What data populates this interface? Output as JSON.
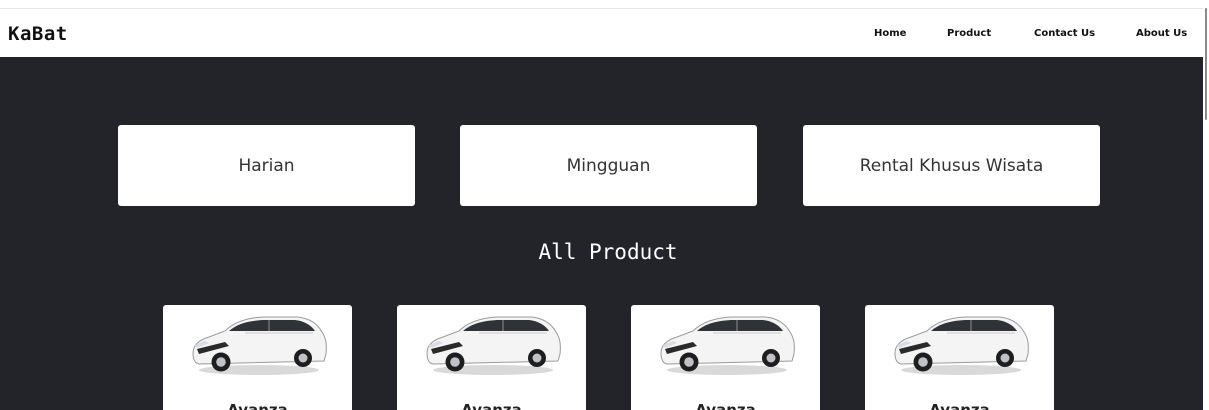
{
  "navbar": {
    "brand": "KaBat",
    "links": [
      "Home",
      "Product",
      "Contact Us",
      "About Us"
    ]
  },
  "categories": [
    "Harian",
    "Mingguan",
    "Rental Khusus Wisata"
  ],
  "section_title": "All Product",
  "products": [
    {
      "name": "Avanza",
      "image": "white-minivan-image"
    },
    {
      "name": "Avanza",
      "image": "white-minivan-image"
    },
    {
      "name": "Avanza",
      "image": "white-minivan-image"
    },
    {
      "name": "Avanza",
      "image": "white-minivan-image"
    }
  ],
  "colors": {
    "hero_background": "#222429",
    "navbar_background": "#ffffff",
    "card_background": "#ffffff"
  }
}
